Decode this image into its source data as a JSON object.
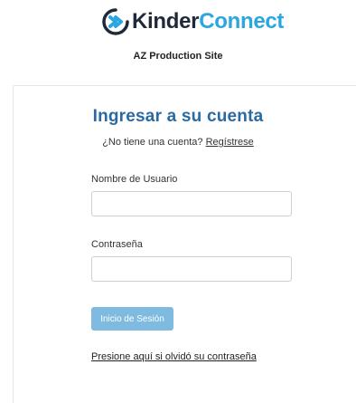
{
  "brand": {
    "name_part1": "Kinder",
    "name_part2": "Connect",
    "logo_icon": "chevron-swirl-icon",
    "colors": {
      "dark": "#1e2a3a",
      "accent": "#2aa6e0",
      "title": "#2a6aa0",
      "button": "#7fbbe0"
    }
  },
  "site_name": "AZ Production Site",
  "login": {
    "title": "Ingresar a su cuenta",
    "signup_prompt": "¿No tiene una cuenta?",
    "signup_link": "Regístrese",
    "username_label": "Nombre de Usuario",
    "username_value": "",
    "password_label": "Contraseña",
    "password_value": "",
    "submit_label": "Inicio de Sesión",
    "forgot_link": "Presione aquí si olvidó su contraseña"
  }
}
